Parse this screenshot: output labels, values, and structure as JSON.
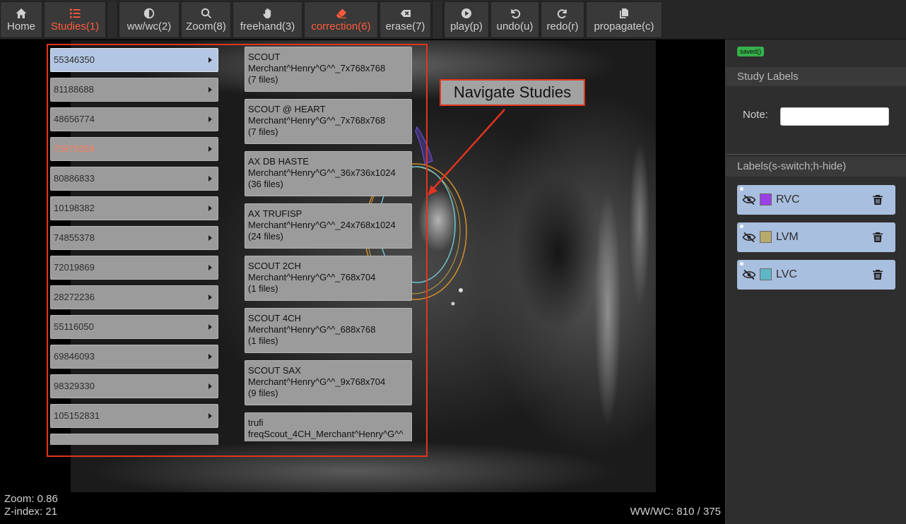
{
  "colors": {
    "accent": "#ff5b3b",
    "selected_study_bg": "#b3c6e4",
    "highlighted_study_text": "#ff7f5c",
    "annotation_red": "#e2341f",
    "saved_badge": "#35b04a",
    "label_card_bg": "#a9bfdf"
  },
  "toolbar": {
    "home": {
      "label": "Home",
      "icon": "home-icon"
    },
    "studies": {
      "label": "Studies(1)",
      "icon": "list-icon",
      "active": true
    },
    "wwwc": {
      "label": "ww/wc(2)",
      "icon": "contrast-icon"
    },
    "zoom": {
      "label": "Zoom(8)",
      "icon": "search-icon"
    },
    "freehand": {
      "label": "freehand(3)",
      "icon": "hand-icon"
    },
    "correction": {
      "label": "correction(6)",
      "icon": "eraser-icon",
      "active": true
    },
    "erase": {
      "label": "erase(7)",
      "icon": "backspace-icon"
    },
    "play": {
      "label": "play(p)",
      "icon": "play-icon"
    },
    "undo": {
      "label": "undo(u)",
      "icon": "undo-icon"
    },
    "redo": {
      "label": "redo(r)",
      "icon": "redo-icon"
    },
    "propagate": {
      "label": "propagate(c)",
      "icon": "copy-icon"
    }
  },
  "viewer": {
    "zoom_text": "Zoom: 0.86",
    "zindex_text": "Z-index: 21",
    "wwwc_text": "WW/WC: 810 / 375"
  },
  "studies_menu": {
    "studies": [
      {
        "id": "55346350",
        "selected": true
      },
      {
        "id": "81188688"
      },
      {
        "id": "48656774"
      },
      {
        "id": "75979359",
        "highlighted": true
      },
      {
        "id": "80886833"
      },
      {
        "id": "10198382"
      },
      {
        "id": "74855378"
      },
      {
        "id": "72019869"
      },
      {
        "id": "28272236"
      },
      {
        "id": "55116050"
      },
      {
        "id": "69846093"
      },
      {
        "id": "98329330"
      },
      {
        "id": "105152831"
      }
    ],
    "series": [
      {
        "name": "SCOUT",
        "detail": "Merchant^Henry^G^^_7x768x768",
        "files": "(7 files)"
      },
      {
        "name": "SCOUT @ HEART",
        "detail": "Merchant^Henry^G^^_7x768x768",
        "files": "(7 files)"
      },
      {
        "name": "AX DB HASTE",
        "detail": "Merchant^Henry^G^^_36x736x1024",
        "files": "(36 files)"
      },
      {
        "name": "AX TRUFISP",
        "detail": "Merchant^Henry^G^^_24x768x1024",
        "files": "(24 files)"
      },
      {
        "name": "SCOUT 2CH",
        "detail": "Merchant^Henry^G^^_768x704",
        "files": "(1 files)"
      },
      {
        "name": "SCOUT 4CH",
        "detail": "Merchant^Henry^G^^_688x768",
        "files": "(1 files)"
      },
      {
        "name": "SCOUT SAX",
        "detail": "Merchant^Henry^G^^_9x768x704",
        "files": "(9 files)"
      },
      {
        "name": "trufi",
        "detail": "freqScout_4CH_Merchant^Henry^G^^"
      }
    ]
  },
  "annotation": {
    "callout_text": "Navigate Studies"
  },
  "sidebar": {
    "status_badge": "saved()",
    "study_labels_header": "Study Labels",
    "note_label": "Note:",
    "note_value": "",
    "labels_header": "Labels(s-switch;h-hide)",
    "labels": [
      {
        "name": "RVC",
        "color": "#9b3fe6"
      },
      {
        "name": "LVM",
        "color": "#b8aa6c"
      },
      {
        "name": "LVC",
        "color": "#5fb6c6"
      }
    ]
  }
}
